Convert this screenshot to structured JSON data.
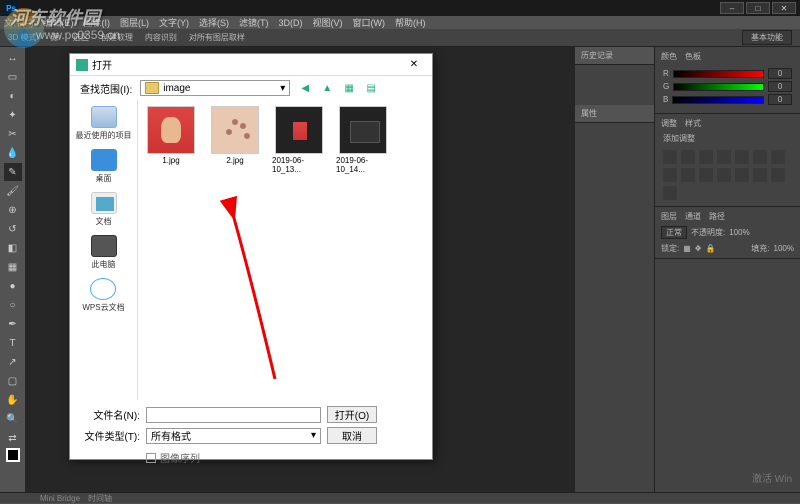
{
  "menubar": [
    "文件(F)",
    "编辑(E)",
    "图像(I)",
    "图层(L)",
    "文字(Y)",
    "选择(S)",
    "滤镜(T)",
    "3D(D)",
    "视图(V)",
    "窗口(W)",
    "帮助(H)"
  ],
  "optbar": {
    "items": [
      "3D 模式:",
      "源:",
      "选区",
      "创建软理",
      "内容识别",
      "对所有图层取样"
    ],
    "workspace": "基本功能"
  },
  "panels": {
    "history": "历史记录",
    "properties": "属性",
    "color_tab": "颜色",
    "swatch_tab": "色板",
    "rgb": {
      "r": "0",
      "g": "0",
      "b": "0"
    },
    "adjust_tab": "调整",
    "style_tab": "样式",
    "adjust_label": "添加调整",
    "layers_tab": "图层",
    "channels_tab": "通道",
    "paths_tab": "路径",
    "blend": "正常",
    "opacity_label": "不透明度:",
    "opacity": "100%",
    "lock_label": "锁定:",
    "fill_label": "填充:",
    "fill": "100%"
  },
  "dialog": {
    "title": "打开",
    "look_label": "查找范围(I):",
    "look_value": "image",
    "sidebar": [
      "最近使用的项目",
      "桌面",
      "文档",
      "此电脑",
      "WPS云文档"
    ],
    "files": [
      {
        "name": "1.jpg"
      },
      {
        "name": "2.jpg"
      },
      {
        "name": "2019-06-10_13..."
      },
      {
        "name": "2019-06-10_14..."
      }
    ],
    "filename_label": "文件名(N):",
    "filename": "",
    "filetype_label": "文件类型(T):",
    "filetype": "所有格式",
    "open_btn": "打开(O)",
    "cancel_btn": "取消",
    "seq_chk": "图像序列"
  },
  "status": {
    "mini": "Mini Bridge",
    "timeline": "时间轴"
  },
  "activate": "激活 Win",
  "watermark": {
    "text": "河东软件园",
    "url": "www.pc0359.cn"
  }
}
